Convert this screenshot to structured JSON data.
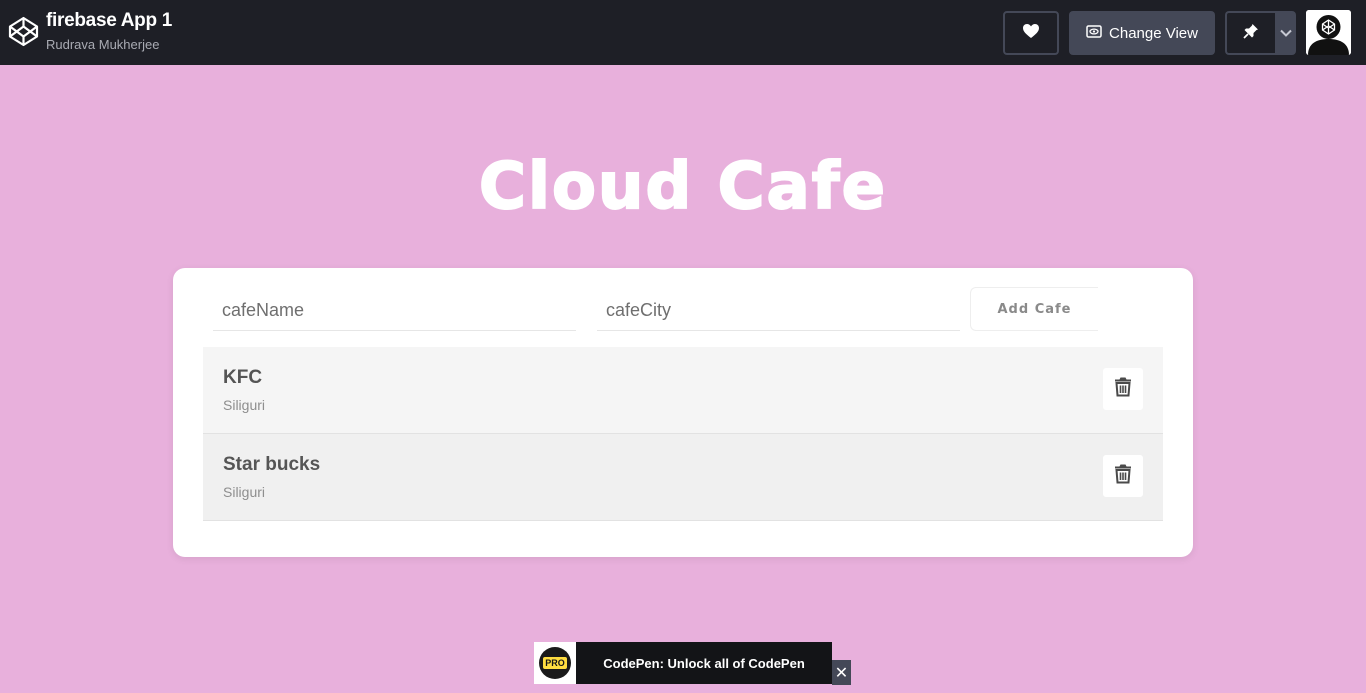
{
  "topbar": {
    "pen_title": "firebase App 1",
    "author": "Rudrava Mukherjee",
    "like_icon": "heart-icon",
    "change_view_label": "Change View",
    "change_view_icon": "eye-icon",
    "pin_icon": "pin-icon",
    "menu_icon": "chevron-down-icon"
  },
  "main": {
    "title": "Cloud Cafe",
    "form": {
      "name_placeholder": "cafeName",
      "city_placeholder": "cafeCity",
      "name_value": "",
      "city_value": "",
      "add_label": "Add Cafe"
    },
    "cafes": [
      {
        "name": "KFC",
        "city": "Siliguri"
      },
      {
        "name": "Star bucks",
        "city": "Siliguri"
      }
    ]
  },
  "promo": {
    "badge": "PRO",
    "text": "CodePen: Unlock all of CodePen",
    "close": "✕"
  },
  "colors": {
    "page_background": "#e8b0dc",
    "topbar_background": "#1e1f26",
    "button_gray": "#444857",
    "pro_yellow": "#ffdd40"
  }
}
